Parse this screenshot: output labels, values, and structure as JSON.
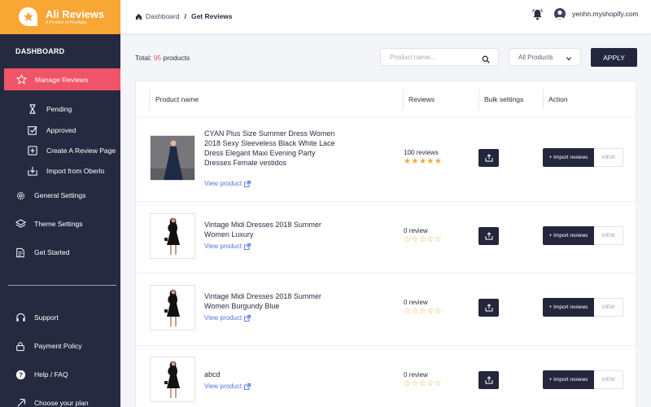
{
  "brand": {
    "name": "Ali Reviews",
    "subtitle": "A Product of FireApps"
  },
  "sidebar": {
    "heading": "DASHBOARD",
    "manage_reviews": "Manage Reviews",
    "sub_items": [
      "Pending",
      "Approved",
      "Create A Review Page",
      "Import from Oberlo"
    ],
    "general_settings": "General Settings",
    "theme_settings": "Theme Settings",
    "get_started": "Get Started",
    "bottom_items": [
      "Support",
      "Payment Policy",
      "Help / FAQ",
      "Choose your plan"
    ]
  },
  "topbar": {
    "breadcrumb_root": "Dashboard",
    "breadcrumb_sep": "/",
    "breadcrumb_current": "Get Reviews",
    "store": "yenhn.myshopify.com"
  },
  "toolbar": {
    "total_label": "Total:",
    "total_count": "95",
    "total_suffix": "products",
    "search_placeholder": "Product name...",
    "filter_value": "All Products",
    "apply_label": "APPLY"
  },
  "table": {
    "headers": {
      "product": "Product name",
      "reviews": "Reviews",
      "bulk": "Bulk settings",
      "action": "Action"
    },
    "view_product_label": "View product",
    "import_label": "+ Import reviews",
    "view_label": "VIEW",
    "rows": [
      {
        "name": "CYAN Plus Size Summer Dress Women 2018 Sexy Sleeveless Black White Lace Dress Elegant Maxi Evening Party Dresses Female vestidos",
        "reviews": "100 reviews",
        "rating": 5
      },
      {
        "name": "Vintage Midi Dresses 2018 Summer Women Luxury",
        "reviews": "0 review",
        "rating": 0
      },
      {
        "name": "Vintage Midi Dresses 2018 Summer Women Burgundy Blue",
        "reviews": "0 review",
        "rating": 0
      },
      {
        "name": "abcd",
        "reviews": "0 review",
        "rating": 0
      }
    ]
  },
  "colors": {
    "accent": "#f8a634",
    "active": "#f05468",
    "dark": "#262a40",
    "link": "#4f73e8"
  }
}
